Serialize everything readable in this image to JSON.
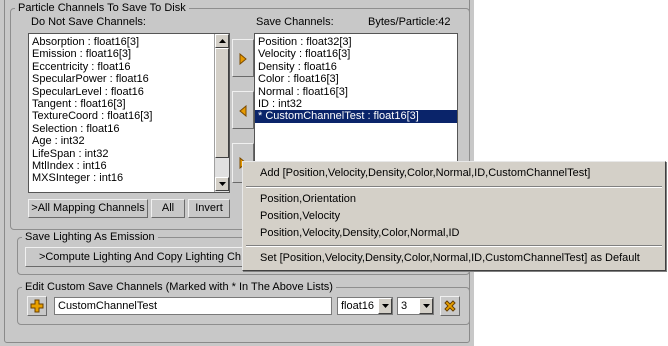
{
  "particle_channels": {
    "group_title": "Particle Channels To Save To Disk",
    "do_not_save_label": "Do Not Save Channels:",
    "do_not_save_items": [
      "Absorption  :  float16[3]",
      "Emission  :  float16[3]",
      "Eccentricity  :  float16",
      "SpecularPower  :  float16",
      "SpecularLevel  :  float16",
      "Tangent  :  float16[3]",
      "TextureCoord  :  float16[3]",
      "Selection  :  float16",
      "Age  :  int32",
      "LifeSpan  :  int32",
      "MtlIndex  :  int16",
      "MXSInteger  :  int16"
    ],
    "save_label": "Save Channels:",
    "bytes_label": "Bytes/Particle:42",
    "save_items": [
      "Position  :  float32[3]",
      "Velocity  :  float16[3]",
      "Density  :  float16",
      "Color  :  float16[3]",
      "Normal  :  float16[3]",
      "ID  :  int32",
      "* CustomChannelTest  :  float16[3]"
    ],
    "selected_save_index": 6,
    "all_mapping_label": ">All Mapping Channels",
    "all_label": "All",
    "invert_label": "Invert"
  },
  "save_lighting": {
    "group_title": "Save Lighting As Emission",
    "compute_label": ">Compute Lighting And Copy Lighting Ch"
  },
  "custom_channels": {
    "group_title": "Edit Custom Save Channels (Marked with * In The Above Lists)",
    "name_value": "CustomChannelTest",
    "type_value": "float16",
    "count_value": "3"
  },
  "context_menu": {
    "items": [
      "Add [Position,Velocity,Density,Color,Normal,ID,CustomChannelTest]",
      "Position,Orientation",
      "Position,Velocity",
      "Position,Velocity,Density,Color,Normal,ID",
      "Set [Position,Velocity,Density,Color,Normal,ID,CustomChannelTest] as Default"
    ]
  },
  "colors": {
    "panel_bg": "#c8c8c8",
    "selection_bg": "#0a246a",
    "arrow_orange": "#e89a00",
    "plus_orange": "#e8a000"
  },
  "icons": {
    "move_right": "triangle-right-icon",
    "move_left": "triangle-left-icon",
    "add": "plus-icon",
    "delete": "x-delete-icon"
  }
}
